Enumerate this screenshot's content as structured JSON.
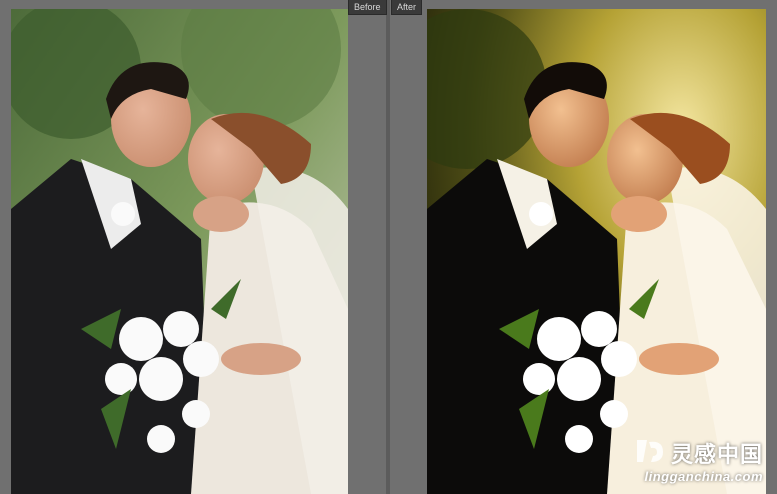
{
  "labels": {
    "before": "Before",
    "after": "After"
  },
  "watermark": {
    "chinese": "灵感中国",
    "url": "lingganchina.com",
    "icon": "lg-logo-icon"
  },
  "colors": {
    "panel_bg": "#707070",
    "label_bg": "#3a3a3a",
    "label_text": "#d8d8d8"
  }
}
